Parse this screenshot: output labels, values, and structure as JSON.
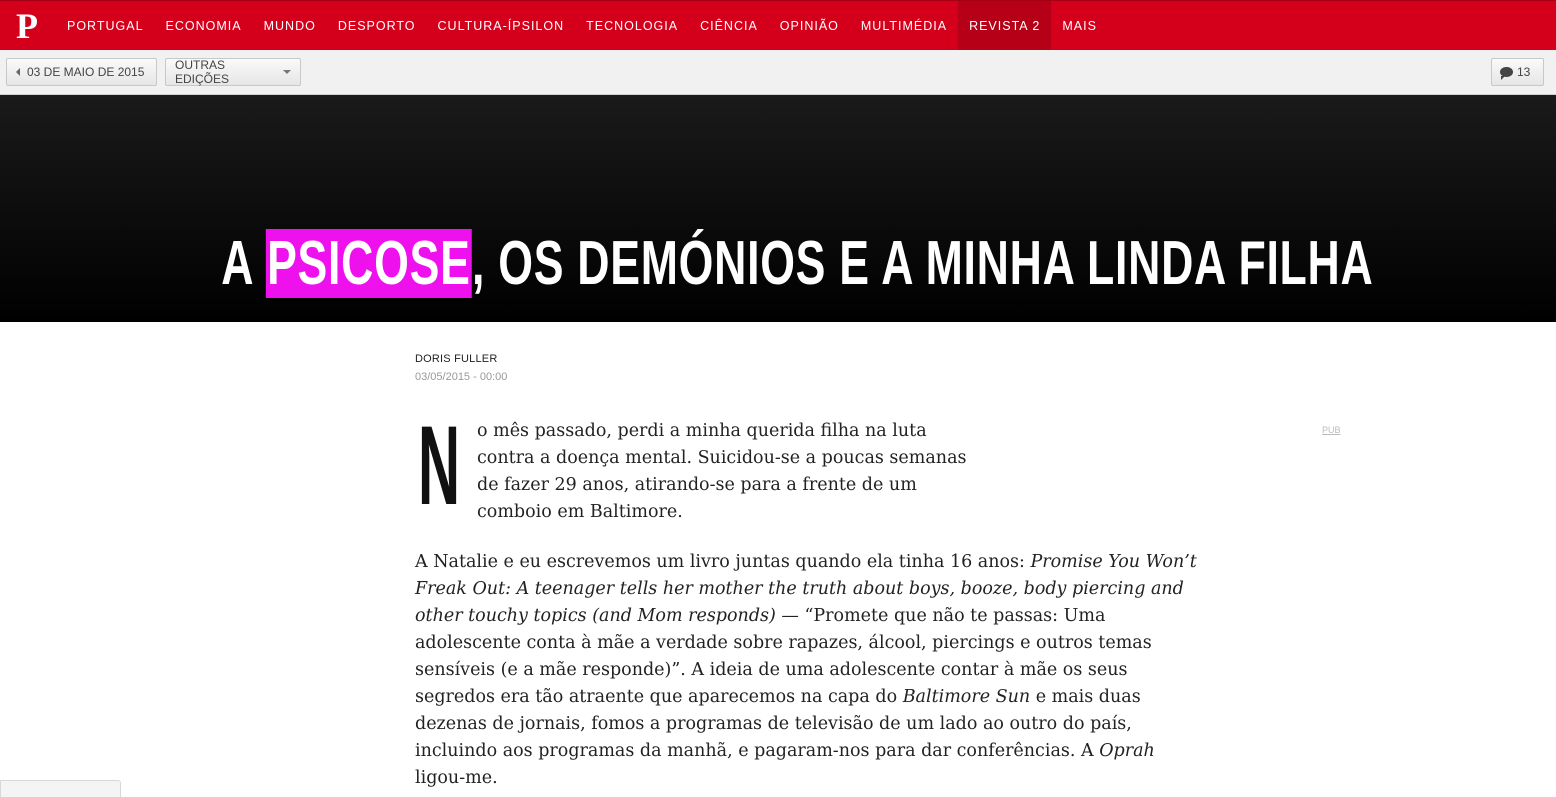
{
  "nav": {
    "logo": "P",
    "items": [
      "PORTUGAL",
      "ECONOMIA",
      "MUNDO",
      "DESPORTO",
      "CULTURA-ÍPSILON",
      "TECNOLOGIA",
      "CIÊNCIA",
      "OPINIÃO",
      "MULTIMÉDIA",
      "REVISTA 2",
      "MAIS"
    ],
    "active_item": "REVISTA 2"
  },
  "subbar": {
    "date_label": "03 DE MAIO DE 2015",
    "other_editions_label": "OUTRAS EDIÇÕES",
    "comments_count": "13"
  },
  "hero": {
    "title_before": "A ",
    "title_highlight": "PSICOSE",
    "title_after": ", OS DEMÓNIOS E A MINHA LINDA FILHA",
    "highlight_color": "#ee11ee"
  },
  "article": {
    "author": "DORIS FULLER",
    "datetime": "03/05/2015 - 00:00",
    "pub_label": "PUB",
    "dropcap": "N",
    "p1_lines": [
      "o mês passado, perdi a minha querida filha na luta",
      "contra a doença mental. Suicidou-se a poucas semanas",
      "de fazer 29 anos, atirando-se para a frente de um",
      "comboio em Baltimore."
    ],
    "p2": {
      "l1_a": "A Natalie e eu escrevemos um livro juntas quando ela tinha 16 anos: ",
      "l1_b": "Promise You Won’t",
      "l2": "Freak Out: A teenager tells her mother the truth about boys, booze, body piercing and",
      "l3_a": "other touchy topics (and Mom responds)",
      "l3_b": " — “Promete que não te passas: Uma",
      "l4": "adolescente conta à mãe a verdade sobre rapazes, álcool, piercings e outros temas",
      "l5": "sensíveis (e a mãe responde)”. A ideia de uma adolescente contar à mãe os seus",
      "l6_a": "segredos era tão atraente que aparecemos na capa do ",
      "l6_b": "Baltimore Sun",
      "l6_c": " e mais duas",
      "l7": "dezenas de jornais, fomos a programas de televisão de um lado ao outro do país,",
      "l8_a": "incluindo aos programas da manhã, e pagaram-nos para dar conferências. A ",
      "l8_b": "Oprah",
      "l9": "ligou-me."
    }
  },
  "colors": {
    "brand_red": "#d4001b",
    "hero_bg": "#000000"
  }
}
